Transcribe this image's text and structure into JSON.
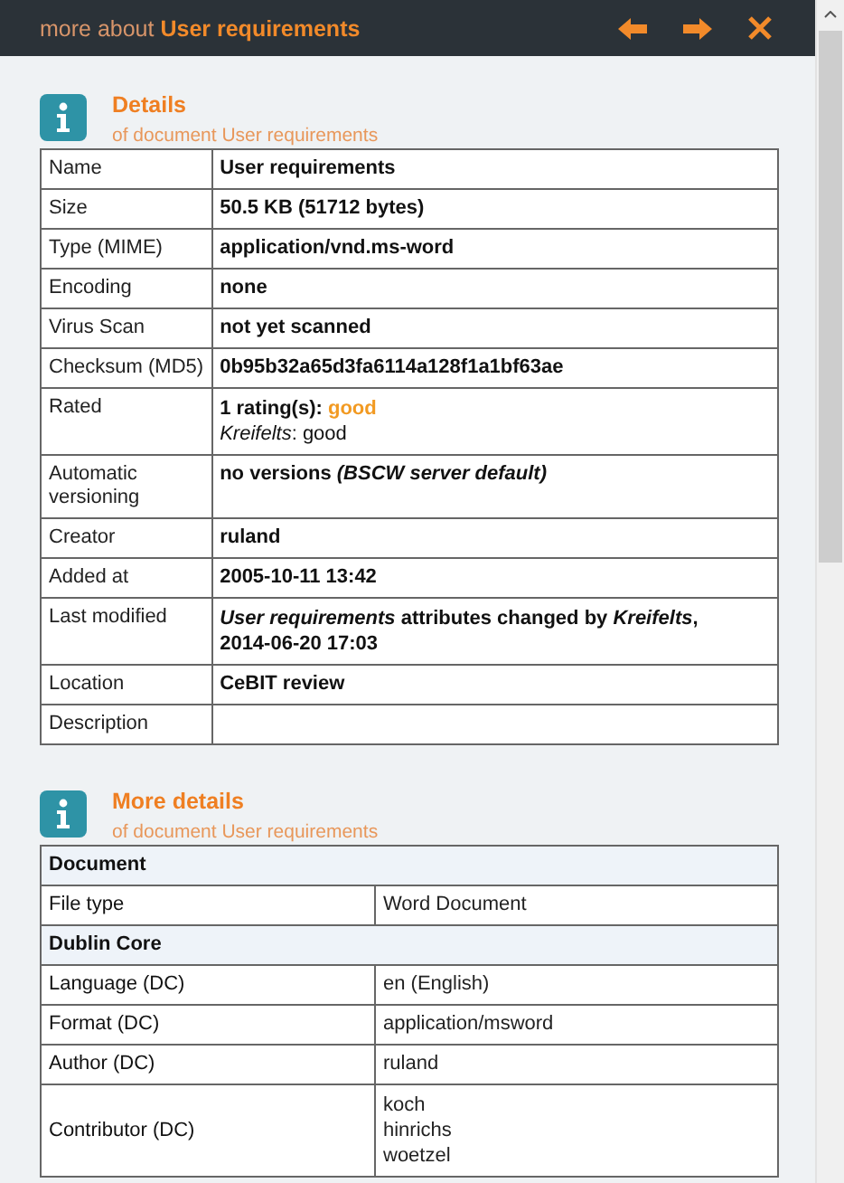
{
  "header": {
    "prefix": "more about",
    "title": "User requirements"
  },
  "details": {
    "title": "Details",
    "subtitle": "of document User requirements",
    "rows": [
      {
        "kind": "text",
        "label": "Name",
        "value": "User requirements"
      },
      {
        "kind": "text",
        "label": "Size",
        "value": "50.5 KB (51712 bytes)"
      },
      {
        "kind": "text",
        "label": "Type (MIME)",
        "value": "application/vnd.ms-word"
      },
      {
        "kind": "text",
        "label": "Encoding",
        "value": "none"
      },
      {
        "kind": "text",
        "label": "Virus Scan",
        "value": "not yet scanned"
      },
      {
        "kind": "text",
        "label": "Checksum (MD5)",
        "value": "0b95b32a65d3fa6114a128f1a1bf63ae"
      },
      {
        "kind": "rating",
        "label": "Rated",
        "count": "1 rating(s):",
        "rating": "good",
        "by": "*Kreifelts*: good"
      },
      {
        "kind": "text",
        "label": "Automatic versioning",
        "value": "no versions *(BSCW server default)*"
      },
      {
        "kind": "text",
        "label": "Creator",
        "value": "ruland"
      },
      {
        "kind": "text",
        "label": "Added at",
        "value": "2005-10-11 13:42"
      },
      {
        "kind": "lines",
        "label": "Last modified",
        "lines": [
          "*User requirements* attributes changed by *Kreifelts*,",
          "2014-06-20 17:03"
        ]
      },
      {
        "kind": "text",
        "label": "Location",
        "value": "CeBIT review"
      },
      {
        "kind": "text",
        "label": "Description",
        "value": ""
      }
    ]
  },
  "more_details": {
    "title": "More details",
    "subtitle": "of document User requirements",
    "rows": [
      {
        "kind": "group",
        "label": "Document"
      },
      {
        "kind": "pair",
        "label": "File type",
        "lines": [
          "Word Document"
        ]
      },
      {
        "kind": "group",
        "label": "Dublin Core"
      },
      {
        "kind": "pair",
        "label": "Language (DC)",
        "lines": [
          "en (English)"
        ]
      },
      {
        "kind": "pair",
        "label": "Format (DC)",
        "lines": [
          "application/msword"
        ]
      },
      {
        "kind": "pair",
        "label": "Author (DC)",
        "lines": [
          "ruland"
        ]
      },
      {
        "kind": "pair",
        "label": "Contributor (DC)",
        "lines": [
          "koch",
          "hinrichs",
          "woetzel"
        ]
      }
    ]
  }
}
